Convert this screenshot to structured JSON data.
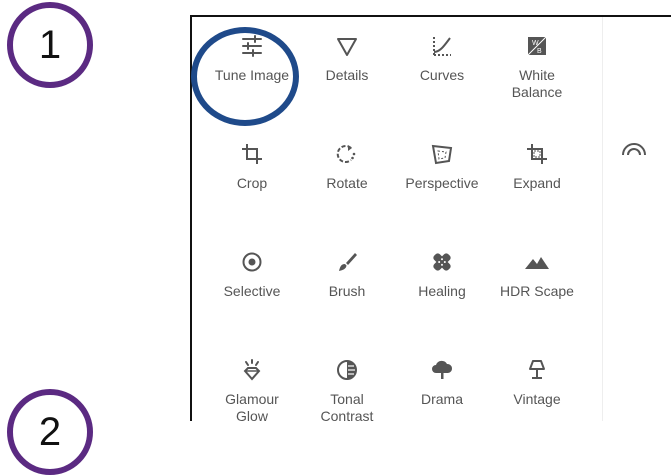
{
  "annotations": {
    "step1": "1",
    "step2": "2",
    "ring_color": "#1f4a8a",
    "badge_color": "#5b2a82"
  },
  "tools": [
    {
      "label": "Tune Image",
      "icon": "tune-sliders-icon"
    },
    {
      "label": "Details",
      "icon": "triangle-details-icon"
    },
    {
      "label": "Curves",
      "icon": "curves-icon"
    },
    {
      "label": "White\nBalance",
      "icon": "white-balance-icon"
    },
    {
      "label": "Crop",
      "icon": "crop-icon"
    },
    {
      "label": "Rotate",
      "icon": "rotate-icon"
    },
    {
      "label": "Perspective",
      "icon": "perspective-icon"
    },
    {
      "label": "Expand",
      "icon": "expand-icon"
    },
    {
      "label": "Selective",
      "icon": "selective-target-icon"
    },
    {
      "label": "Brush",
      "icon": "brush-icon"
    },
    {
      "label": "Healing",
      "icon": "healing-bandage-icon"
    },
    {
      "label": "HDR Scape",
      "icon": "hdr-mountain-icon"
    },
    {
      "label": "Glamour\nGlow",
      "icon": "glamour-glow-icon"
    },
    {
      "label": "Tonal\nContrast",
      "icon": "tonal-contrast-icon"
    },
    {
      "label": "Drama",
      "icon": "drama-cloud-icon"
    },
    {
      "label": "Vintage",
      "icon": "vintage-lamp-icon"
    }
  ],
  "side_rail": {
    "icon": "rail-arc-icon"
  }
}
